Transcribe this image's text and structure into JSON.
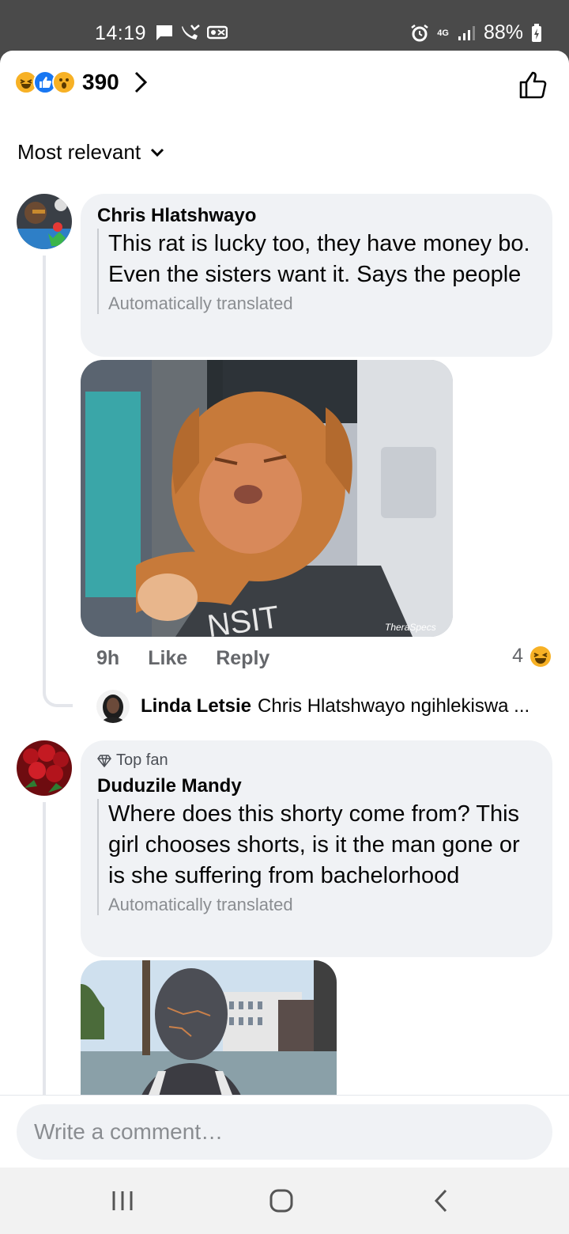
{
  "status_bar": {
    "time": "14:19",
    "network": "4G",
    "battery": "88%"
  },
  "reactions": {
    "count": "390",
    "types": [
      "haha",
      "like",
      "wow"
    ]
  },
  "sort": {
    "label": "Most relevant"
  },
  "comments": [
    {
      "author": "Chris Hlatshwayo",
      "text": "This rat is lucky too, they have money bo. Even the sisters want it. Says the people",
      "translated_label": "Automatically translated",
      "image_watermark": "TheraSpecs",
      "image_sign_text": "NSIT",
      "time": "9h",
      "like_label": "Like",
      "reply_label": "Reply",
      "reaction_count": "4",
      "reply": {
        "author": "Linda Letsie",
        "text": "Chris Hlatshwayo ngihlekiswa ..."
      }
    },
    {
      "badge": "Top fan",
      "author": "Duduzile Mandy",
      "text": "Where does this shorty come from? This girl chooses shorts, is it the man gone or is she suffering from bachelorhood",
      "translated_label": "Automatically translated"
    }
  ],
  "composer": {
    "placeholder": "Write a comment…"
  },
  "colors": {
    "bubble": "#f0f2f5",
    "like_blue": "#1877f2",
    "haha_yellow": "#f7b125",
    "muted_text": "#65676b"
  },
  "icons": [
    "message-icon",
    "missed-call-icon",
    "vr-icon",
    "alarm-icon",
    "signal-icon",
    "battery-icon",
    "chevron-right-icon",
    "like-outline-icon",
    "chevron-down-icon",
    "diamond-icon",
    "recents-icon",
    "home-icon",
    "back-icon"
  ]
}
